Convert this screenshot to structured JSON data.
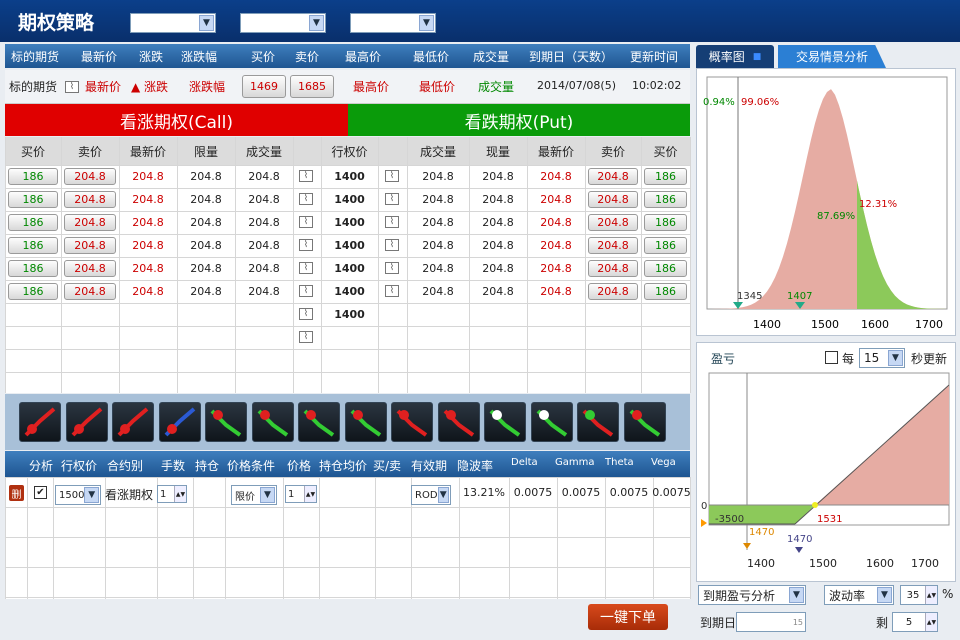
{
  "app": {
    "title": "期权策略"
  },
  "colors": {
    "header_bg": "#0b3f8a",
    "call_bg": "#e00000",
    "put_bg": "#0a9b0a",
    "red": "#cc0000",
    "green": "#008800",
    "profit_pink": "#e6aca3",
    "profit_green": "#8cc95a"
  },
  "quote": {
    "headers": [
      "标的期货",
      "最新价",
      "涨跌",
      "涨跌幅",
      "买价",
      "卖价",
      "最高价",
      "最低价",
      "成交量",
      "到期日（天数）",
      "更新时间"
    ],
    "label": "标的期货",
    "chart_icon": "chart-icon",
    "last": "最新价",
    "change": "▲ 涨跌",
    "change_pct": "涨跌幅",
    "bid": "1469",
    "ask": "1685",
    "high": "最高价",
    "low": "最低价",
    "volume": "成交量",
    "expiry": "2014/07/08(5)",
    "time": "10:02:02"
  },
  "call_title": "看涨期权(Call)",
  "put_title": "看跌期权(Put)",
  "options_headers": {
    "call": [
      "买价",
      "卖价",
      "最新价",
      "限量",
      "成交量"
    ],
    "strike": "行权价",
    "put": [
      "成交量",
      "现量",
      "最新价",
      "卖价",
      "买价"
    ]
  },
  "options_rows": [
    {
      "c_bid": "186",
      "c_ask": "204.8",
      "c_last": "204.8",
      "c_lim": "204.8",
      "c_vol": "204.8",
      "strike": "1400",
      "p_vol": "204.8",
      "p_cur": "204.8",
      "p_last": "204.8",
      "p_ask": "204.8",
      "p_bid": "186"
    },
    {
      "c_bid": "186",
      "c_ask": "204.8",
      "c_last": "204.8",
      "c_lim": "204.8",
      "c_vol": "204.8",
      "strike": "1400",
      "p_vol": "204.8",
      "p_cur": "204.8",
      "p_last": "204.8",
      "p_ask": "204.8",
      "p_bid": "186"
    },
    {
      "c_bid": "186",
      "c_ask": "204.8",
      "c_last": "204.8",
      "c_lim": "204.8",
      "c_vol": "204.8",
      "strike": "1400",
      "p_vol": "204.8",
      "p_cur": "204.8",
      "p_last": "204.8",
      "p_ask": "204.8",
      "p_bid": "186"
    },
    {
      "c_bid": "186",
      "c_ask": "204.8",
      "c_last": "204.8",
      "c_lim": "204.8",
      "c_vol": "204.8",
      "strike": "1400",
      "p_vol": "204.8",
      "p_cur": "204.8",
      "p_last": "204.8",
      "p_ask": "204.8",
      "p_bid": "186"
    },
    {
      "c_bid": "186",
      "c_ask": "204.8",
      "c_last": "204.8",
      "c_lim": "204.8",
      "c_vol": "204.8",
      "strike": "1400",
      "p_vol": "204.8",
      "p_cur": "204.8",
      "p_last": "204.8",
      "p_ask": "204.8",
      "p_bid": "186"
    },
    {
      "c_bid": "186",
      "c_ask": "204.8",
      "c_last": "204.8",
      "c_lim": "204.8",
      "c_vol": "204.8",
      "strike": "1400",
      "p_vol": "204.8",
      "p_cur": "204.8",
      "p_last": "204.8",
      "p_ask": "204.8",
      "p_bid": "186"
    },
    {
      "strike": "1400"
    }
  ],
  "strategy_icons": [
    "strategy-icon-long-call",
    "strategy-icon-bull-call",
    "strategy-icon-bull-spread",
    "strategy-icon-bull-put",
    "strategy-icon-long-put",
    "strategy-icon-bear-put",
    "strategy-icon-bear-spread",
    "strategy-icon-bear-call",
    "strategy-icon-straddle",
    "strategy-icon-strangle",
    "strategy-icon-butterfly",
    "strategy-icon-condor",
    "strategy-icon-ratio",
    "strategy-icon-backspread"
  ],
  "order": {
    "headers": [
      "分析",
      "行权价",
      "合约别",
      "手数",
      "持仓",
      "价格条件",
      "价格",
      "持仓均价",
      "买/卖",
      "有效期",
      "隐波率",
      "Delta",
      "Gamma",
      "Theta",
      "Vega"
    ],
    "delete_label": "删",
    "strike": "1500",
    "contract": "看涨期权",
    "qty": "1",
    "price_cond": "限价",
    "price": "1",
    "validity": "ROD",
    "iv": "13.21%",
    "delta": "0.0075",
    "gamma": "0.0075",
    "theta": "0.0075",
    "vega": "0.0075"
  },
  "submit_label": "一键下单",
  "tabs": [
    "概率图",
    "交易情景分析"
  ],
  "prob_chart": {
    "x_ticks": [
      "1400",
      "1500",
      "1600",
      "1700"
    ],
    "left_pct": "0.94%",
    "mid_pct": "99.06%",
    "inner_pct": "87.69%",
    "right_pct": "12.31%",
    "marker1": "1345",
    "marker2": "1407"
  },
  "pnl": {
    "title": "盈亏",
    "every_label": "每",
    "interval": "15",
    "refresh_label": "秒更新",
    "zero": "0",
    "loss_value": "-3500",
    "breakeven": "1531",
    "marker1": "1470",
    "marker2": "1470",
    "x_ticks": [
      "1400",
      "1500",
      "1600",
      "1700"
    ]
  },
  "bottom_controls": {
    "analysis": "到期盈亏分析",
    "vol_label": "波动率",
    "vol_value": "35",
    "pct": "%",
    "expiry_label": "到期日",
    "expiry_value": "15",
    "remain_label": "剩",
    "remain_value": "5"
  },
  "chart_data": [
    {
      "type": "area",
      "title": "概率图",
      "x_ticks": [
        1400,
        1500,
        1600,
        1700
      ],
      "series": [
        {
          "values": [
            {
              "x": 1345,
              "label": "0.94%"
            },
            {
              "x": 1345,
              "label": "99.06%"
            },
            {
              "x": 1560,
              "label": "87.69%"
            },
            {
              "x": 1560,
              "label": "12.31%"
            }
          ]
        }
      ],
      "markers": [
        1345,
        1407
      ]
    },
    {
      "type": "line",
      "title": "盈亏",
      "x_ticks": [
        1400,
        1500,
        1600,
        1700
      ],
      "series": [
        {
          "values": [
            {
              "x": 1340,
              "y": -3500
            },
            {
              "x": 1470,
              "y": -3500
            },
            {
              "x": 1531,
              "y": 0
            },
            {
              "x": 1750,
              "y": 28000
            }
          ]
        }
      ],
      "markers": [
        1470,
        1470,
        1531
      ]
    }
  ]
}
